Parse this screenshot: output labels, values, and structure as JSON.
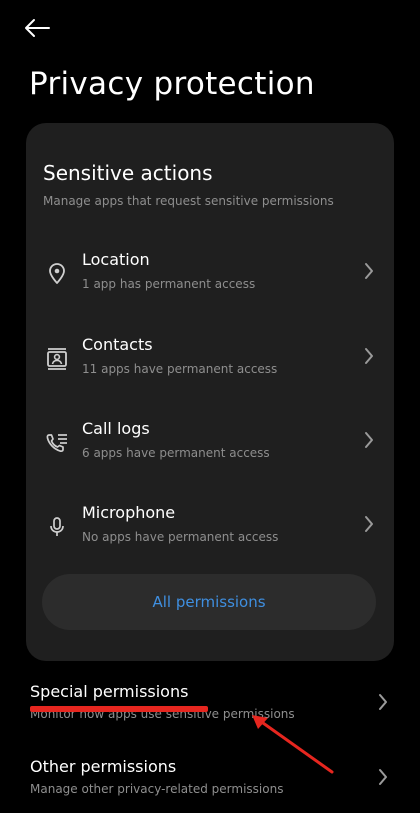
{
  "header": {
    "back_icon": "arrow-left-icon",
    "title": "Privacy protection"
  },
  "sensitive_actions": {
    "title": "Sensitive actions",
    "subtitle": "Manage apps that request sensitive permissions",
    "items": [
      {
        "icon": "location-pin-icon",
        "label": "Location",
        "description": "1 app has permanent access"
      },
      {
        "icon": "contacts-icon",
        "label": "Contacts",
        "description": "11 apps have permanent access"
      },
      {
        "icon": "call-log-icon",
        "label": "Call logs",
        "description": "6 apps have permanent access"
      },
      {
        "icon": "microphone-icon",
        "label": "Microphone",
        "description": "No apps have permanent access"
      }
    ],
    "all_permissions_label": "All permissions"
  },
  "sections": [
    {
      "label": "Special permissions",
      "description": "Monitor how apps use sensitive permissions"
    },
    {
      "label": "Other permissions",
      "description": "Manage other privacy-related permissions"
    }
  ],
  "colors": {
    "background": "#000000",
    "card": "#1f1f1f",
    "accent_link": "#3f8fe0",
    "annotation_red": "#e6261f",
    "secondary_text": "#8e8e8e"
  }
}
